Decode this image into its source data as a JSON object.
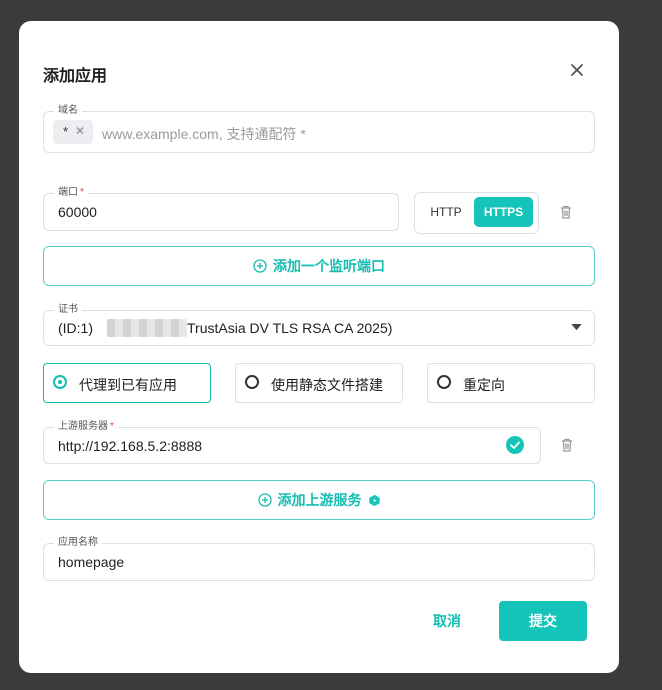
{
  "dialog": {
    "title": "添加应用",
    "close_icon": "close-icon"
  },
  "domain": {
    "label": "域名",
    "chip": "*",
    "placeholder": "www.example.com, 支持通配符 *"
  },
  "port": {
    "label": "端口",
    "required_mark": "*",
    "value": "60000",
    "protocols": [
      "HTTP",
      "HTTPS"
    ],
    "selected_protocol": "HTTPS",
    "add_button": "添加一个监听端口"
  },
  "certificate": {
    "label": "证书",
    "value_prefix": "(ID:1)",
    "value_suffix": "TrustAsia DV TLS RSA CA 2025)"
  },
  "mode": {
    "options": [
      "代理到已有应用",
      "使用静态文件搭建",
      "重定向"
    ],
    "selected_index": 0
  },
  "upstream": {
    "label": "上游服务器",
    "required_mark": "*",
    "value": "http://192.168.5.2:8888",
    "add_button": "添加上游服务"
  },
  "app_name": {
    "label": "应用名称",
    "value": "homepage"
  },
  "actions": {
    "cancel": "取消",
    "submit": "提交"
  },
  "colors": {
    "accent": "#14c4b8",
    "accent_text": "#14bdb0",
    "overlay": "#3b3b3b"
  }
}
